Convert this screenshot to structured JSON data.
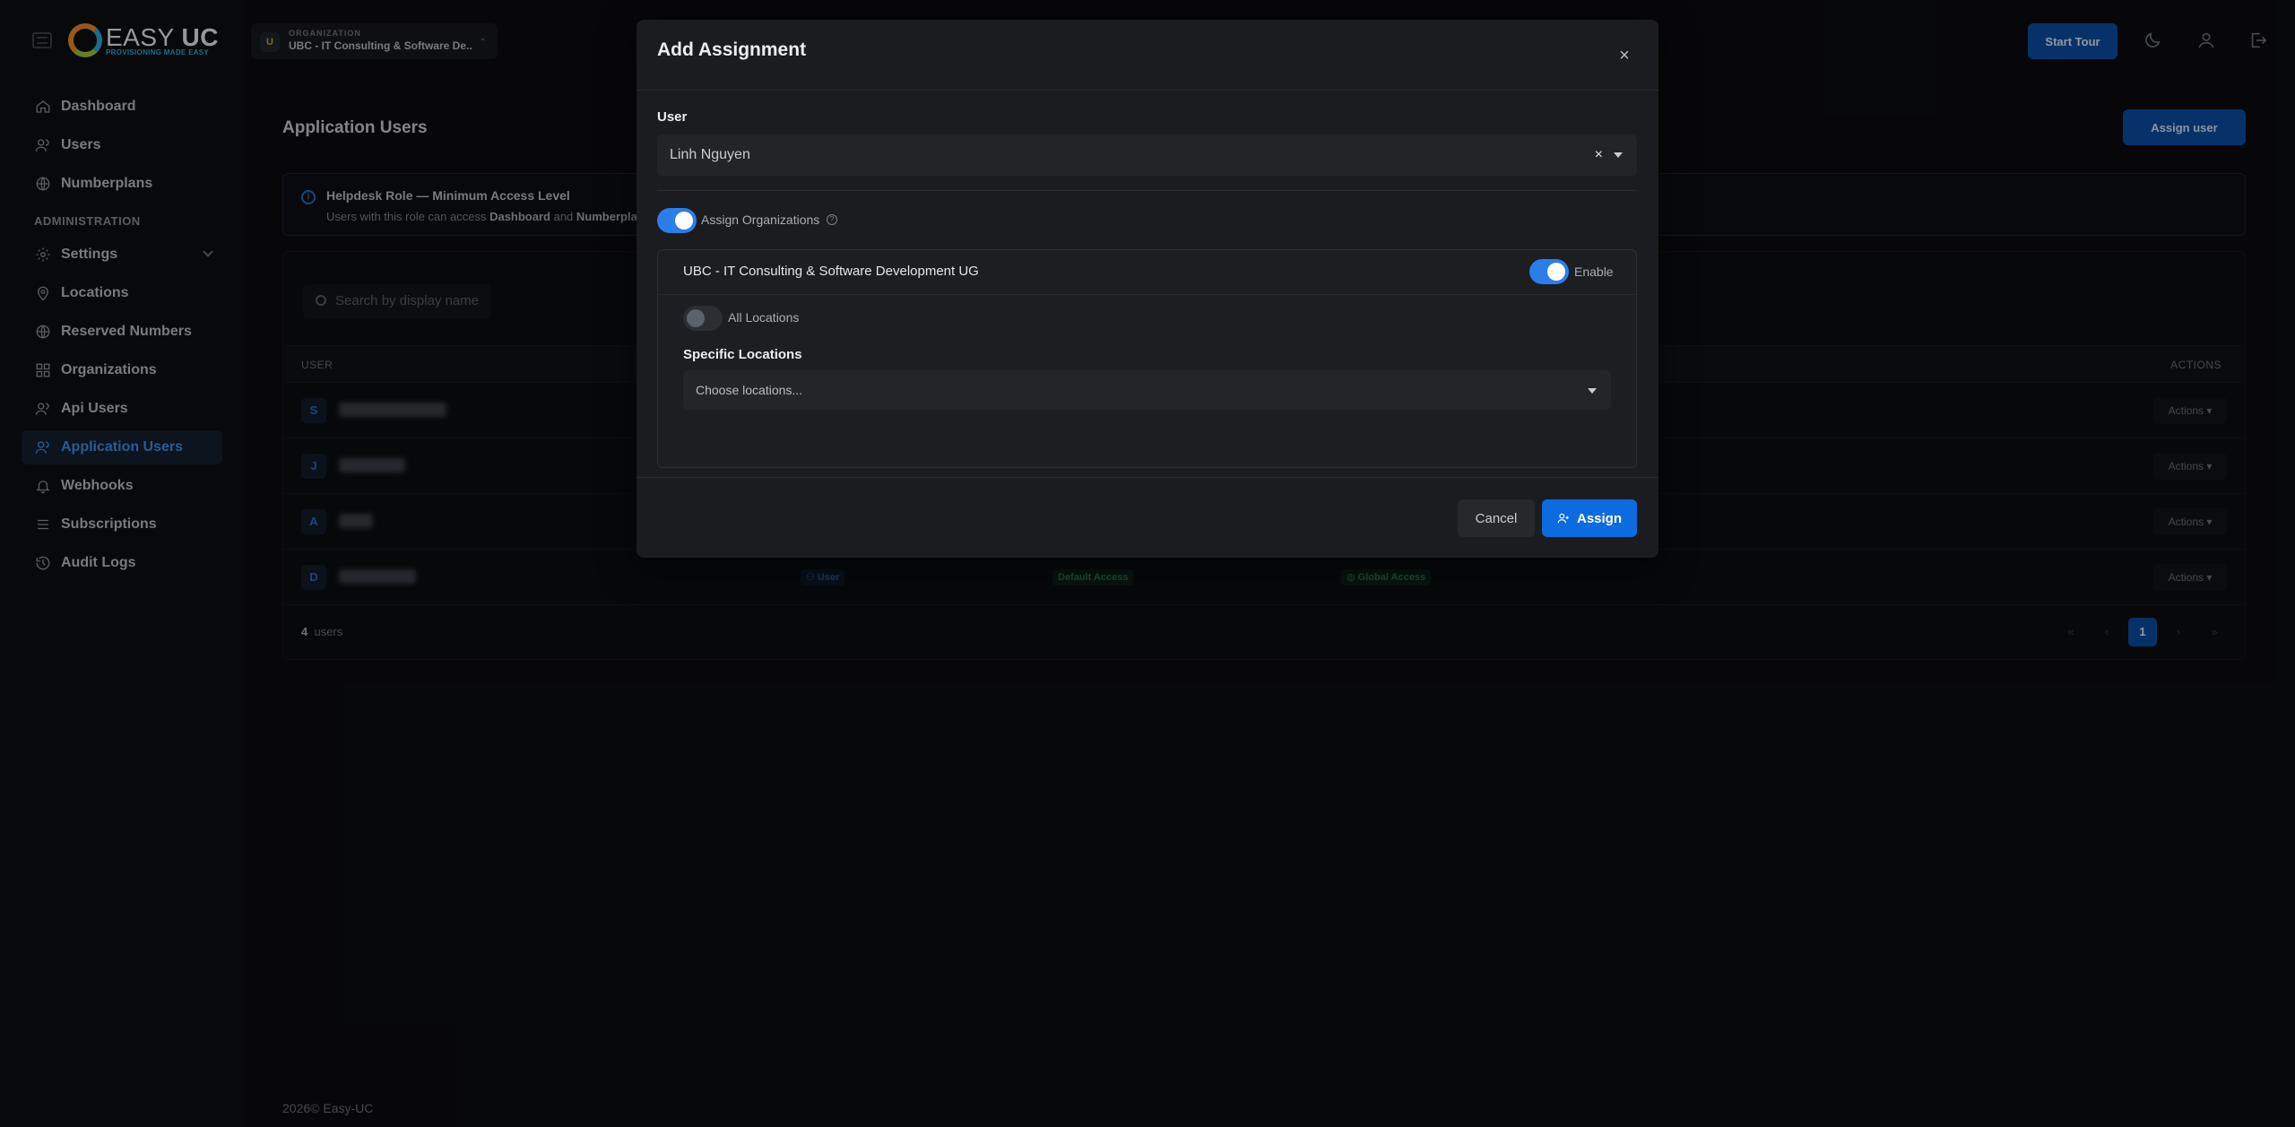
{
  "brand": {
    "name_light": "EASY",
    "name_bold": "UC",
    "tagline": "PROVISIONING MADE EASY"
  },
  "org_switcher": {
    "caption": "ORGANIZATION",
    "badge": "U",
    "name": "UBC - IT Consulting & Software De..."
  },
  "topbar": {
    "start_tour": "Start Tour"
  },
  "sidebar": {
    "items": [
      {
        "label": "Dashboard",
        "icon": "home-icon"
      },
      {
        "label": "Users",
        "icon": "users-icon"
      },
      {
        "label": "Numberplans",
        "icon": "globe-icon"
      }
    ],
    "section": "ADMINISTRATION",
    "admin_items": [
      {
        "label": "Settings",
        "icon": "gear-icon"
      },
      {
        "label": "Locations",
        "icon": "pin-icon"
      },
      {
        "label": "Reserved Numbers",
        "icon": "globe-icon"
      },
      {
        "label": "Organizations",
        "icon": "grid-icon"
      },
      {
        "label": "Api Users",
        "icon": "users-icon"
      },
      {
        "label": "Application Users",
        "icon": "users-icon",
        "active": true
      },
      {
        "label": "Webhooks",
        "icon": "bell-icon"
      },
      {
        "label": "Subscriptions",
        "icon": "list-icon"
      },
      {
        "label": "Audit Logs",
        "icon": "history-icon"
      }
    ]
  },
  "page": {
    "title": "Application Users",
    "assign_user": "Assign user",
    "info": {
      "title": "Helpdesk Role — Minimum Access Level",
      "desc_prefix": "Users with this role can access ",
      "desc_b1": "Dashboard",
      "desc_mid": " and ",
      "desc_b2": "Numberpla"
    },
    "search_placeholder": "Search by display name",
    "columns": {
      "user": "USER",
      "actions": "ACTIONS"
    },
    "rows": [
      {
        "initial": "S",
        "actions": "Actions ▾"
      },
      {
        "initial": "J",
        "actions": "Actions ▾"
      },
      {
        "initial": "A",
        "actions": "Actions ▾"
      },
      {
        "initial": "D",
        "actions": "Actions ▾",
        "role": "User",
        "access": "Default Access",
        "scope": "Global Access"
      }
    ],
    "count": "4",
    "count_suffix": "users",
    "pager": {
      "first": "«",
      "prev": "‹",
      "current": "1",
      "next": "›",
      "last": "»"
    }
  },
  "footer": {
    "copyright": "2026© Easy-UC"
  },
  "modal": {
    "title": "Add Assignment",
    "close": "×",
    "user_label": "User",
    "user_value": "Linh Nguyen",
    "clear": "×",
    "assign_orgs_label": "Assign Organizations",
    "assign_orgs_on": true,
    "help": "?",
    "org_card": {
      "title": "UBC - IT Consulting & Software Development UG",
      "enable_label": "Enable",
      "enable_on": true,
      "all_locations_label": "All Locations",
      "all_locations_on": false,
      "specific_label": "Specific Locations",
      "locations_placeholder": "Choose locations..."
    },
    "cancel": "Cancel",
    "assign": "Assign"
  },
  "colors": {
    "accent": "#0d6be0",
    "active_nav": "#3f8ee8",
    "background": "#0a0b0d",
    "modal": "#1a1c20"
  }
}
